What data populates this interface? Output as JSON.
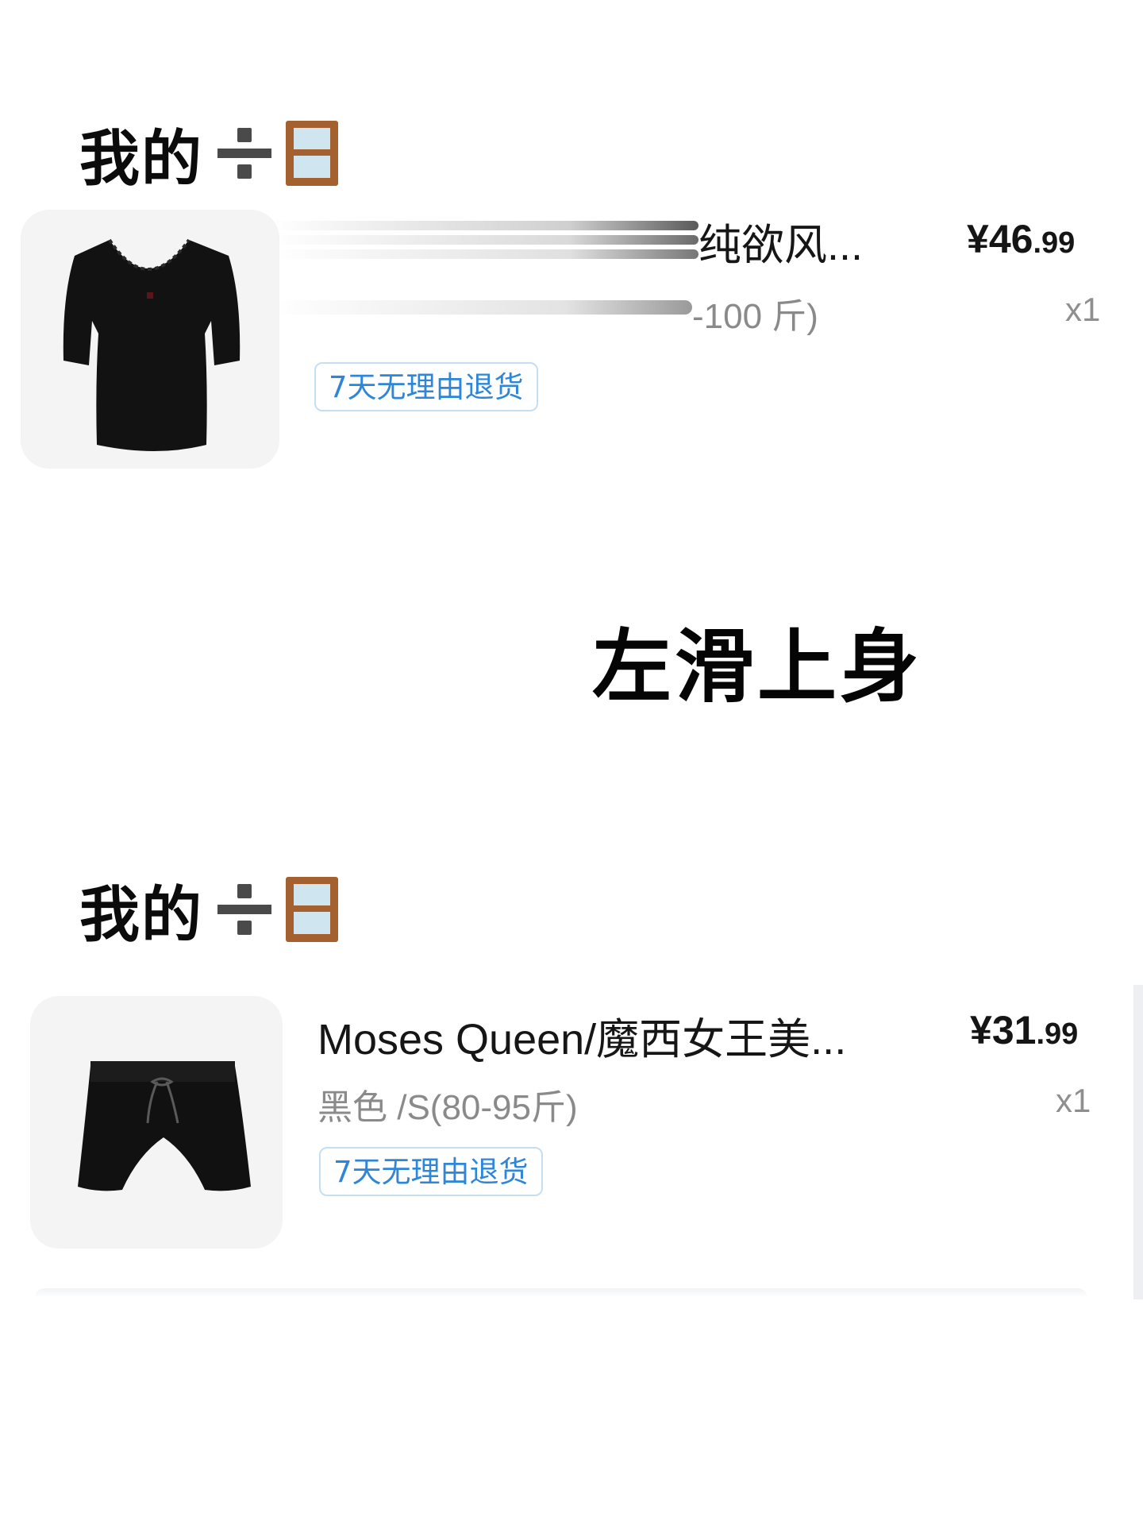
{
  "sections": [
    {
      "heading": "我的",
      "heading_divide_icon": "heavy-division-sign-icon",
      "heading_window_icon": "window-icon",
      "item": {
        "title": "纯欲风...",
        "variant": "-100 斤)",
        "price_currency": "¥",
        "price_integer": "46",
        "price_decimal": ".99",
        "quantity": "x1",
        "badge": "7天无理由退货",
        "image": "black-short-sleeve-v-neck-top"
      }
    },
    {
      "heading": "我的",
      "heading_divide_icon": "heavy-division-sign-icon",
      "heading_window_icon": "window-icon",
      "item": {
        "title": "Moses Queen/魔西女王美...",
        "variant": "黑色 /S(80-95斤)",
        "price_currency": "¥",
        "price_integer": "31",
        "price_decimal": ".99",
        "quantity": "x1",
        "badge": "7天无理由退货",
        "image": "black-drawstring-shorts"
      }
    }
  ],
  "caption": "左滑上身",
  "colors": {
    "badge_text": "#2d86d8",
    "badge_border": "#c4def3",
    "thumb_background": "#f4f4f4",
    "window_frame": "#a5602f",
    "window_glass": "#cfe5ef"
  }
}
